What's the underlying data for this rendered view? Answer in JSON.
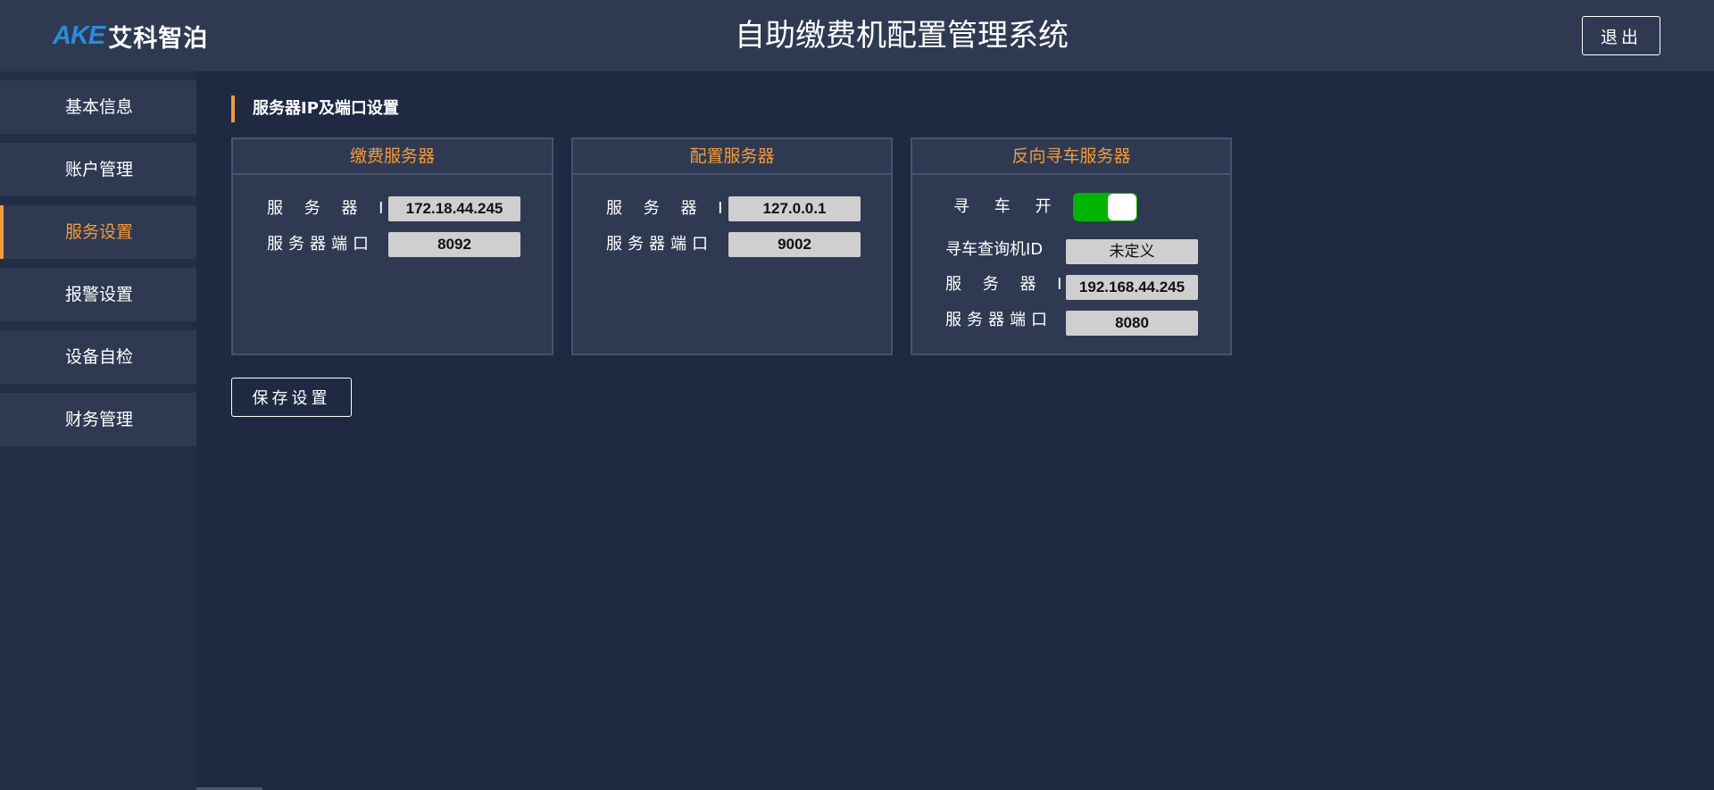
{
  "header": {
    "logo_latin": "AKE",
    "logo_cn": "艾科智泊",
    "title": "自助缴费机配置管理系统",
    "logout_label": "退出"
  },
  "sidebar": {
    "items": [
      {
        "label": "基本信息",
        "active": false
      },
      {
        "label": "账户管理",
        "active": false
      },
      {
        "label": "服务设置",
        "active": true
      },
      {
        "label": "报警设置",
        "active": false
      },
      {
        "label": "设备自检",
        "active": false
      },
      {
        "label": "财务管理",
        "active": false
      }
    ]
  },
  "main": {
    "section_title": "服务器IP及端口设置",
    "panels": {
      "payment": {
        "title": "缴费服务器",
        "ip_label": "服 务 器 IP",
        "ip_value": "172.18.44.245",
        "port_label": "服务器端口",
        "port_value": "8092"
      },
      "config": {
        "title": "配置服务器",
        "ip_label": "服 务 器 IP",
        "ip_value": "127.0.0.1",
        "port_label": "服务器端口",
        "port_value": "9002"
      },
      "reverse": {
        "title": "反向寻车服务器",
        "switch_label": "寻 车 开 关",
        "switch_on": true,
        "query_id_label": "寻车查询机ID",
        "query_id_value": "未定义",
        "ip_label": "服 务 器 IP",
        "ip_value": "192.168.44.245",
        "port_label": "服务器端口",
        "port_value": "8080"
      }
    },
    "save_label": "保存设置"
  },
  "colors": {
    "accent": "#f29a3b",
    "toggle_on": "#00b400",
    "logo_blue": "#2a8bdc",
    "background": "#1f2a42",
    "panel": "#2f3a52"
  }
}
